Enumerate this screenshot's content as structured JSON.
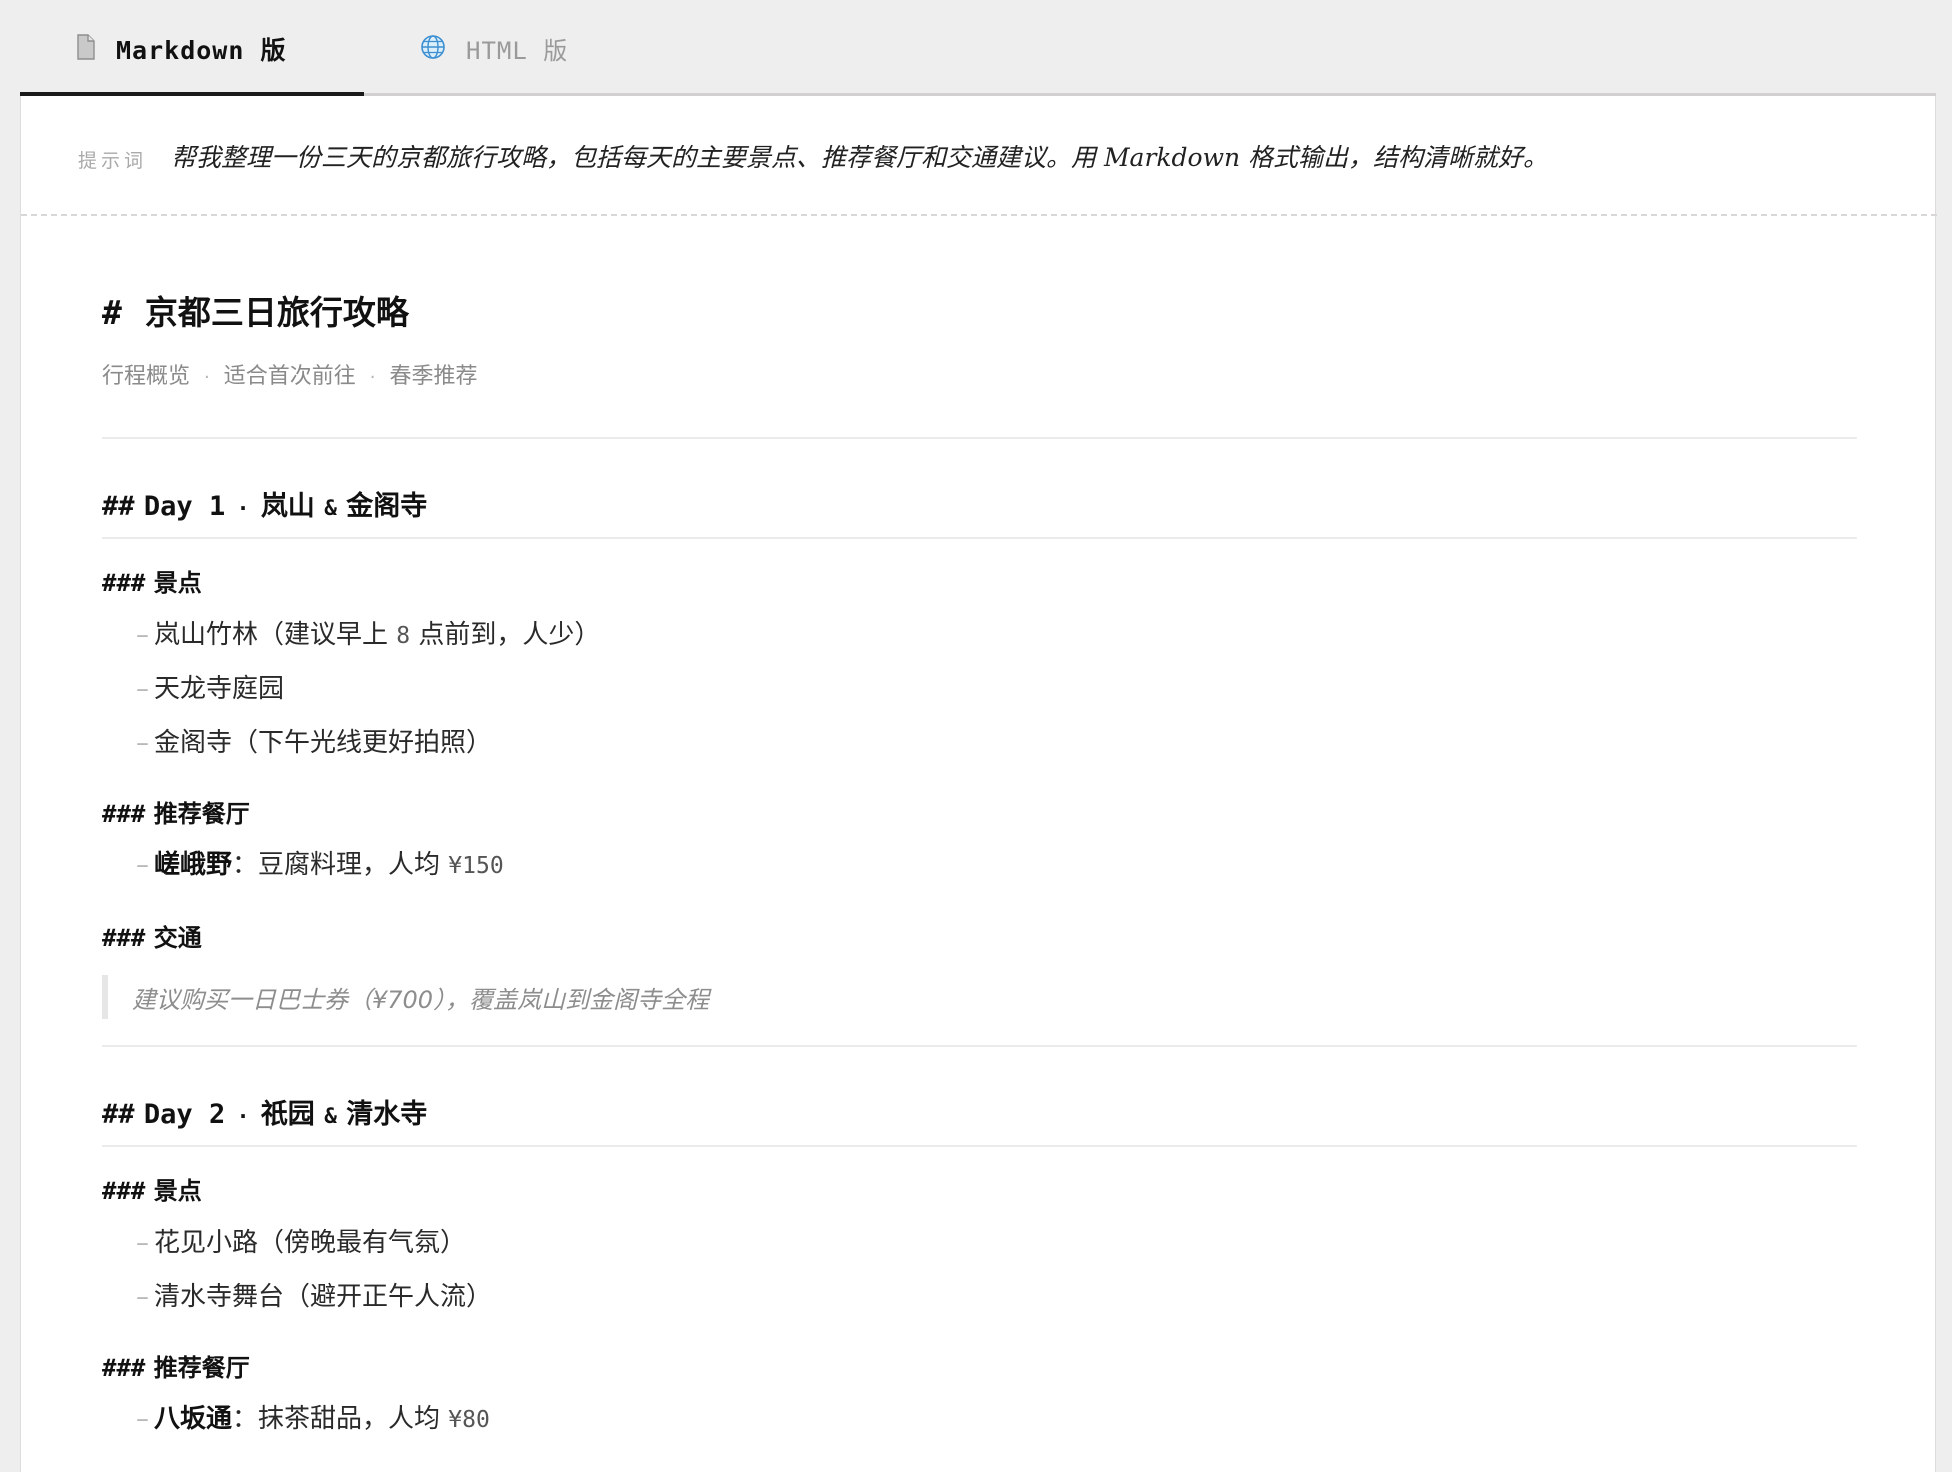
{
  "tabs": {
    "markdown": {
      "label": "Markdown 版",
      "icon": "document-icon"
    },
    "html": {
      "label": "HTML 版",
      "icon": "globe-icon"
    }
  },
  "prompt": {
    "label": "提示词",
    "text": "帮我整理一份三天的京都旅行攻略，包括每天的主要景点、推荐餐厅和交通建议。用 Markdown 格式输出，结构清晰就好。"
  },
  "doc": {
    "title_mark": "#",
    "title": "京都三日旅行攻略",
    "meta": [
      "行程概览",
      "适合首次前往",
      "春季推荐"
    ],
    "meta_sep": "·",
    "h2_mark": "##",
    "h3_mark": "###",
    "list_mark": "–",
    "days": [
      {
        "day": "Day 1",
        "sep": "·",
        "place_a": "岚山",
        "amp": "&",
        "place_b": "金阁寺",
        "sights_heading": "景点",
        "sights": [
          {
            "pre": "岚山竹林（建议早上 ",
            "num": "8",
            "post": " 点前到，人少）"
          },
          {
            "pre": "天龙寺庭园",
            "num": "",
            "post": ""
          },
          {
            "pre": "金阁寺（下午光线更好拍照）",
            "num": "",
            "post": ""
          }
        ],
        "food_heading": "推荐餐厅",
        "food": [
          {
            "name": "嵯峨野",
            "desc": "：豆腐料理，人均 ",
            "price": "¥150"
          }
        ],
        "transport_heading": "交通",
        "transport": "建议购买一日巴士券（¥700），覆盖岚山到金阁寺全程"
      },
      {
        "day": "Day 2",
        "sep": "·",
        "place_a": "祇园",
        "amp": "&",
        "place_b": "清水寺",
        "sights_heading": "景点",
        "sights": [
          {
            "pre": "花见小路（傍晚最有气氛）",
            "num": "",
            "post": ""
          },
          {
            "pre": "清水寺舞台（避开正午人流）",
            "num": "",
            "post": ""
          }
        ],
        "food_heading": "推荐餐厅",
        "food": [
          {
            "name": "八坂通",
            "desc": "：抹茶甜品，人均 ",
            "price": "¥80"
          }
        ]
      }
    ]
  }
}
